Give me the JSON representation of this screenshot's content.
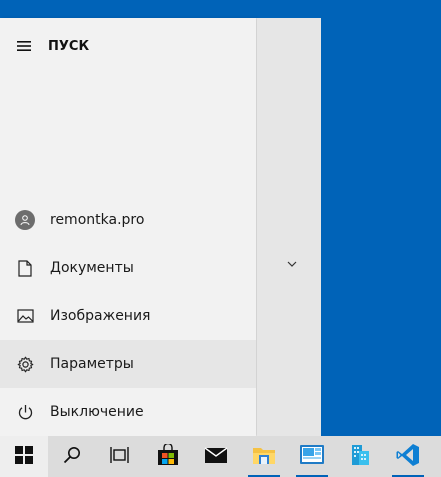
{
  "start": {
    "title": "ПУСК",
    "items": [
      {
        "label": "remontka.pro",
        "icon": "user-avatar-icon"
      },
      {
        "label": "Документы",
        "icon": "document-icon"
      },
      {
        "label": "Изображения",
        "icon": "image-icon"
      },
      {
        "label": "Параметры",
        "icon": "gear-icon"
      },
      {
        "label": "Выключение",
        "icon": "power-icon"
      }
    ]
  },
  "taskbar": {
    "icons": [
      "windows-logo-icon",
      "search-icon",
      "task-view-icon",
      "store-icon",
      "mail-icon",
      "file-explorer-icon",
      "app-icon",
      "stack-app-icon",
      "vscode-icon"
    ]
  },
  "colors": {
    "desktop": "#0063b8",
    "menu_bg": "#f2f2f2",
    "taskbar": "#dcdcdc",
    "accent": "#0078d7"
  }
}
